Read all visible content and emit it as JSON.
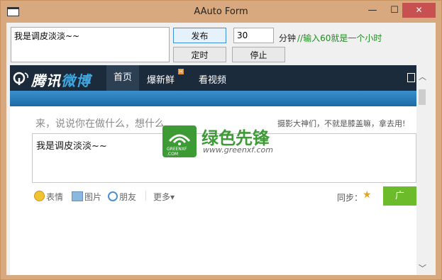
{
  "window": {
    "title": "AAuto Form",
    "minimize_glyph": "—",
    "maximize_glyph": "☐",
    "close_glyph": "✕"
  },
  "form": {
    "message_text": "我是调皮淡淡~~",
    "publish_label": "发布",
    "timer_label": "定时",
    "stop_label": "停止",
    "minutes_value": "30",
    "minutes_unit": "分钟",
    "hint": "//输入60就是一个小时"
  },
  "browser": {
    "logo_text_main": "腾讯",
    "logo_text_accent": "微博",
    "nav": {
      "home": "首页",
      "hot": "爆新鲜",
      "hot_badge": "H",
      "video": "看视频"
    },
    "prompt": "来，说说你在做什么，想什么",
    "side_link": "摄影大神们，不就是膝盖嘛，拿去用!",
    "compose_text": "我是调皮淡淡~~",
    "toolbar": {
      "emoji": "表情",
      "picture": "图片",
      "friend": "朋友",
      "more": "更多▾"
    },
    "sync_label": "同步：",
    "send_label": "广"
  },
  "watermark": {
    "small": "GREENXF\n.COM",
    "name": "绿色先锋",
    "url": "www.greenxf.com"
  },
  "colors": {
    "titlebar": "#d8a97e",
    "close": "#c75050",
    "nav": "#1b2b3c",
    "hint": "#1e8c1e",
    "send": "#6bbb2a",
    "watermark": "#3d9b35"
  }
}
